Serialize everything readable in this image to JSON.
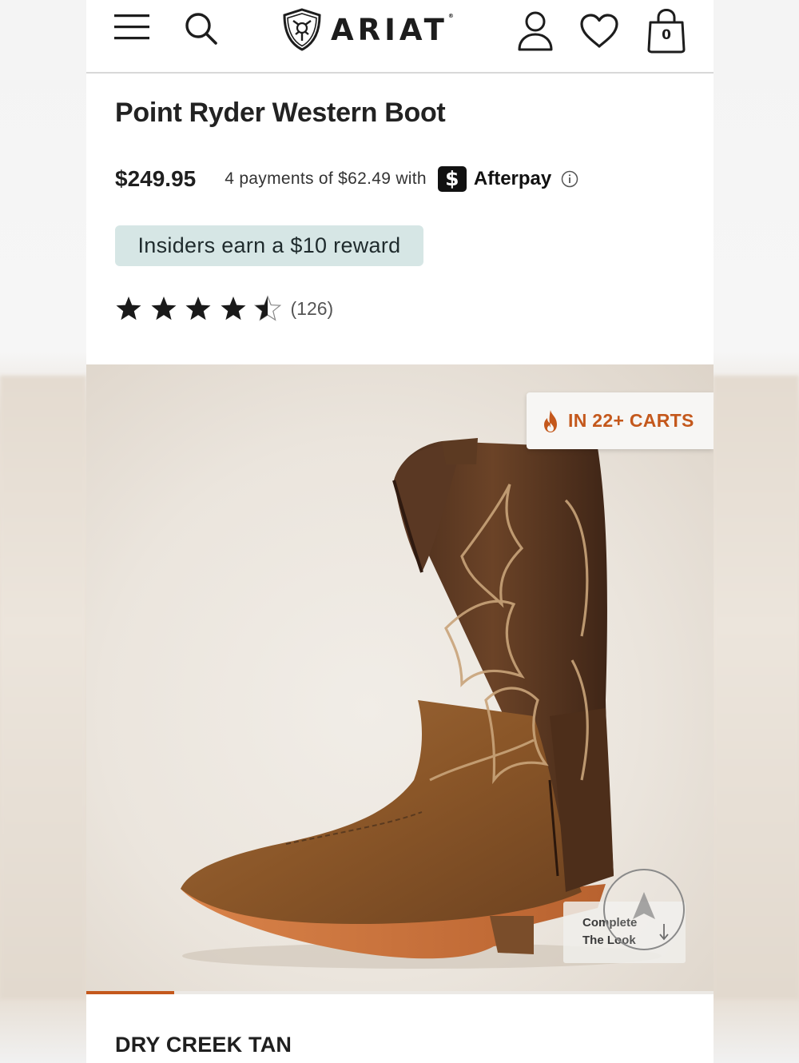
{
  "header": {
    "logo_text": "ARIAT",
    "logo_mark": "®",
    "cart_count": "0"
  },
  "product": {
    "title": "Point Ryder Western Boot",
    "price": "$249.95",
    "installments_text": "4 payments of $62.49 with",
    "afterpay_symbol": "$",
    "afterpay_label": "Afterpay",
    "reward_text": "Insiders earn a $10 reward",
    "rating_value": 4.5,
    "rating_max": 5,
    "review_count": "(126)",
    "color_name": "DRY CREEK TAN"
  },
  "gallery": {
    "carts_badge": "IN 22+ CARTS",
    "complete_look_line1": "Complete",
    "complete_look_line2": "The Look",
    "progress_fraction": 0.14
  },
  "icons": {
    "menu": "menu-icon",
    "search": "search-icon",
    "account": "account-icon",
    "wishlist": "heart-icon",
    "bag": "bag-icon",
    "info": "info-icon",
    "fire": "fire-icon"
  },
  "colors": {
    "accent": "#c4581c",
    "reward_bg": "#d6e6e5",
    "text": "#1d1d1d"
  }
}
